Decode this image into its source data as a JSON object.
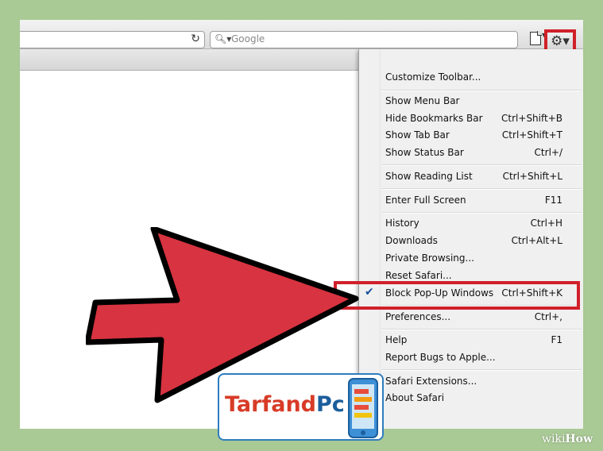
{
  "search": {
    "placeholder": "Google"
  },
  "icons": {
    "reload": "reload-icon",
    "search": "magnifier-icon",
    "page": "page-icon",
    "gear": "gear-icon",
    "checkmark": "checkmark-icon"
  },
  "colors": {
    "highlight": "#d0202a",
    "arrow": "#d83340",
    "background": "#a9c995",
    "check": "#1a4f9e"
  },
  "menu": {
    "items": [
      {
        "label": "Customize Toolbar...",
        "shortcut": ""
      },
      {
        "label": "Show Menu Bar",
        "shortcut": ""
      },
      {
        "label": "Hide Bookmarks Bar",
        "shortcut": "Ctrl+Shift+B"
      },
      {
        "label": "Show Tab Bar",
        "shortcut": "Ctrl+Shift+T"
      },
      {
        "label": "Show Status Bar",
        "shortcut": "Ctrl+/"
      },
      {
        "label": "Show Reading List",
        "shortcut": "Ctrl+Shift+L"
      },
      {
        "label": "Enter Full Screen",
        "shortcut": "F11"
      },
      {
        "label": "History",
        "shortcut": "Ctrl+H"
      },
      {
        "label": "Downloads",
        "shortcut": "Ctrl+Alt+L"
      },
      {
        "label": "Private Browsing...",
        "shortcut": ""
      },
      {
        "label": "Reset Safari...",
        "shortcut": ""
      },
      {
        "label": "Block Pop-Up Windows",
        "shortcut": "Ctrl+Shift+K",
        "checked": true
      },
      {
        "label": "Preferences...",
        "shortcut": "Ctrl+,"
      },
      {
        "label": "Help",
        "shortcut": "F1"
      },
      {
        "label": "Report Bugs to Apple...",
        "shortcut": ""
      },
      {
        "label": "Safari Extensions...",
        "shortcut": ""
      },
      {
        "label": "About Safari",
        "shortcut": ""
      }
    ]
  },
  "watermark": {
    "brand_part1": "Tarfand",
    "brand_part2": "Pc",
    "wiki": "wiki",
    "how": "How"
  }
}
